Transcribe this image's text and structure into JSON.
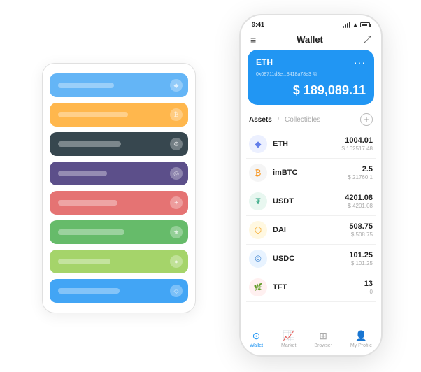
{
  "app": {
    "title": "Wallet"
  },
  "status_bar": {
    "time": "9:41",
    "battery": "100"
  },
  "header": {
    "menu_icon": "≡",
    "title": "Wallet",
    "expand_icon": "⤢"
  },
  "eth_card": {
    "label": "ETH",
    "more_icon": "···",
    "address": "0x08711d3e...8418a78e3",
    "copy_icon": "⧉",
    "balance_prefix": "$",
    "balance": "189,089.11"
  },
  "assets": {
    "tab_active": "Assets",
    "separator": "/",
    "tab_inactive": "Collectibles",
    "add_icon": "+"
  },
  "asset_list": [
    {
      "symbol": "ETH",
      "icon": "◆",
      "icon_color": "#627eea",
      "amount": "1004.01",
      "usd": "$ 162517.48"
    },
    {
      "symbol": "imBTC",
      "icon": "₿",
      "icon_color": "#f7931a",
      "amount": "2.5",
      "usd": "$ 21760.1"
    },
    {
      "symbol": "USDT",
      "icon": "₮",
      "icon_color": "#26a17b",
      "amount": "4201.08",
      "usd": "$ 4201.08"
    },
    {
      "symbol": "DAI",
      "icon": "◎",
      "icon_color": "#f5a623",
      "amount": "508.75",
      "usd": "$ 508.75"
    },
    {
      "symbol": "USDC",
      "icon": "©",
      "icon_color": "#2775ca",
      "amount": "101.25",
      "usd": "$ 101.25"
    },
    {
      "symbol": "TFT",
      "icon": "🌿",
      "icon_color": "#e84040",
      "amount": "13",
      "usd": "0"
    }
  ],
  "bottom_nav": [
    {
      "label": "Wallet",
      "icon": "⊙",
      "active": true
    },
    {
      "label": "Market",
      "icon": "📈",
      "active": false
    },
    {
      "label": "Browser",
      "icon": "⊞",
      "active": false
    },
    {
      "label": "My Profile",
      "icon": "👤",
      "active": false
    }
  ],
  "card_stack": {
    "colors": [
      "#64b5f6",
      "#ffb74d",
      "#37474f",
      "#5c4f8a",
      "#e57373",
      "#66bb6a",
      "#a5d46a",
      "#42a5f5"
    ],
    "line_widths": [
      "80px",
      "100px",
      "90px",
      "70px",
      "85px",
      "95px",
      "75px",
      "88px"
    ]
  }
}
